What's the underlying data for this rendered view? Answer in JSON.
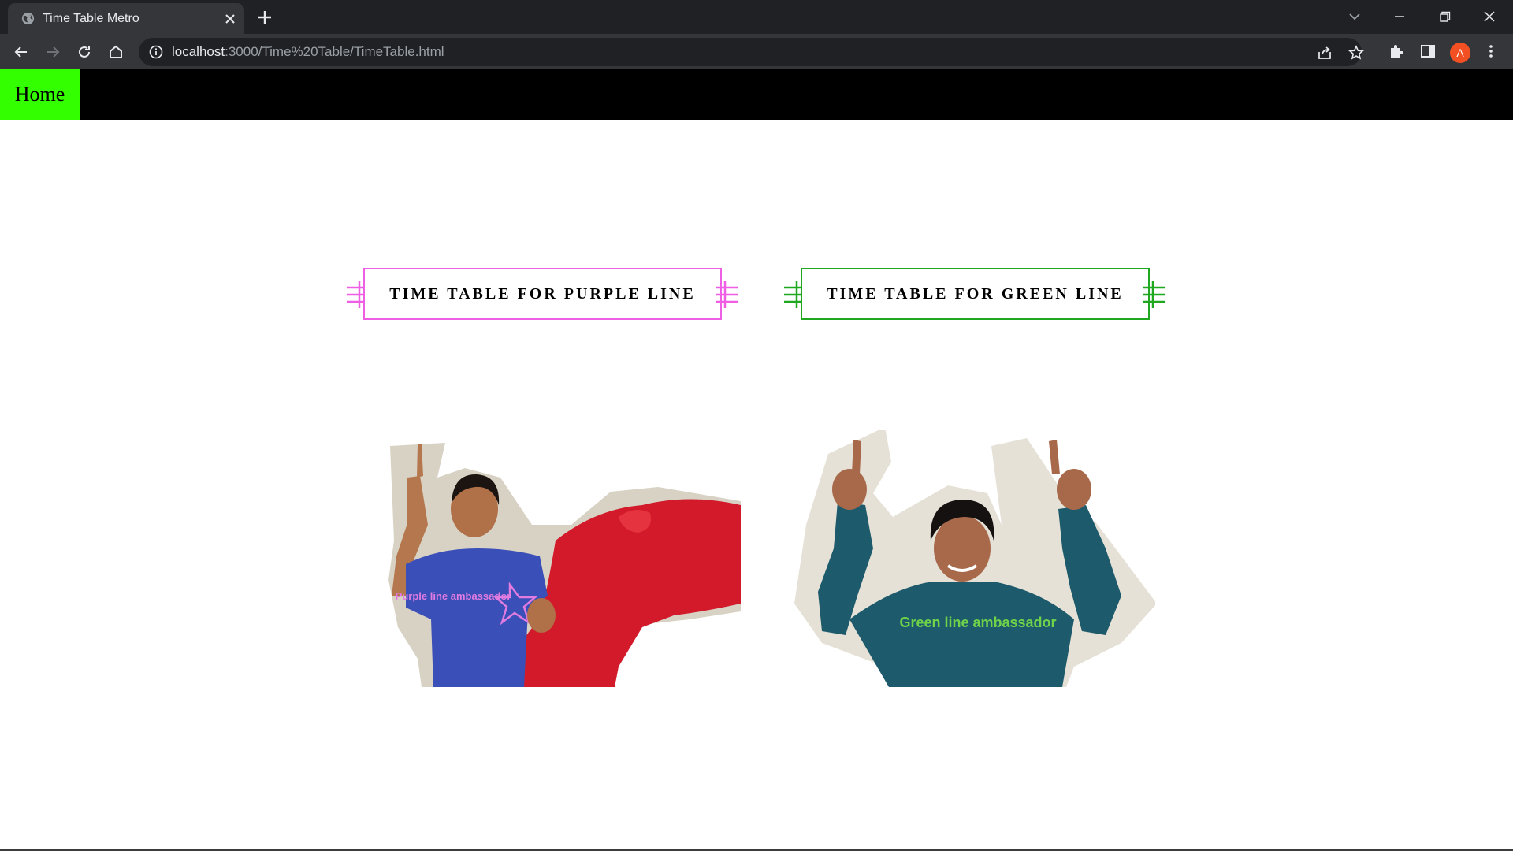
{
  "browser": {
    "tab_title": "Time Table Metro",
    "url_host": "localhost",
    "url_rest": ":3000/Time%20Table/TimeTable.html",
    "profile_initial": "A"
  },
  "nav": {
    "home_label": "Home"
  },
  "buttons": [
    {
      "label": "TIME TABLE FOR PURPLE LINE",
      "color": "#ef5fe4"
    },
    {
      "label": "TIME TABLE FOR GREEN LINE",
      "color": "#1fa81f"
    }
  ],
  "photos": [
    {
      "caption": "Purple line ambassador",
      "shirt_color": "#3b4fb8",
      "caption_color": "#e07be0"
    },
    {
      "caption": "Green line ambassador",
      "shirt_color": "#1d5a6b",
      "caption_color": "#6fd34a"
    }
  ]
}
